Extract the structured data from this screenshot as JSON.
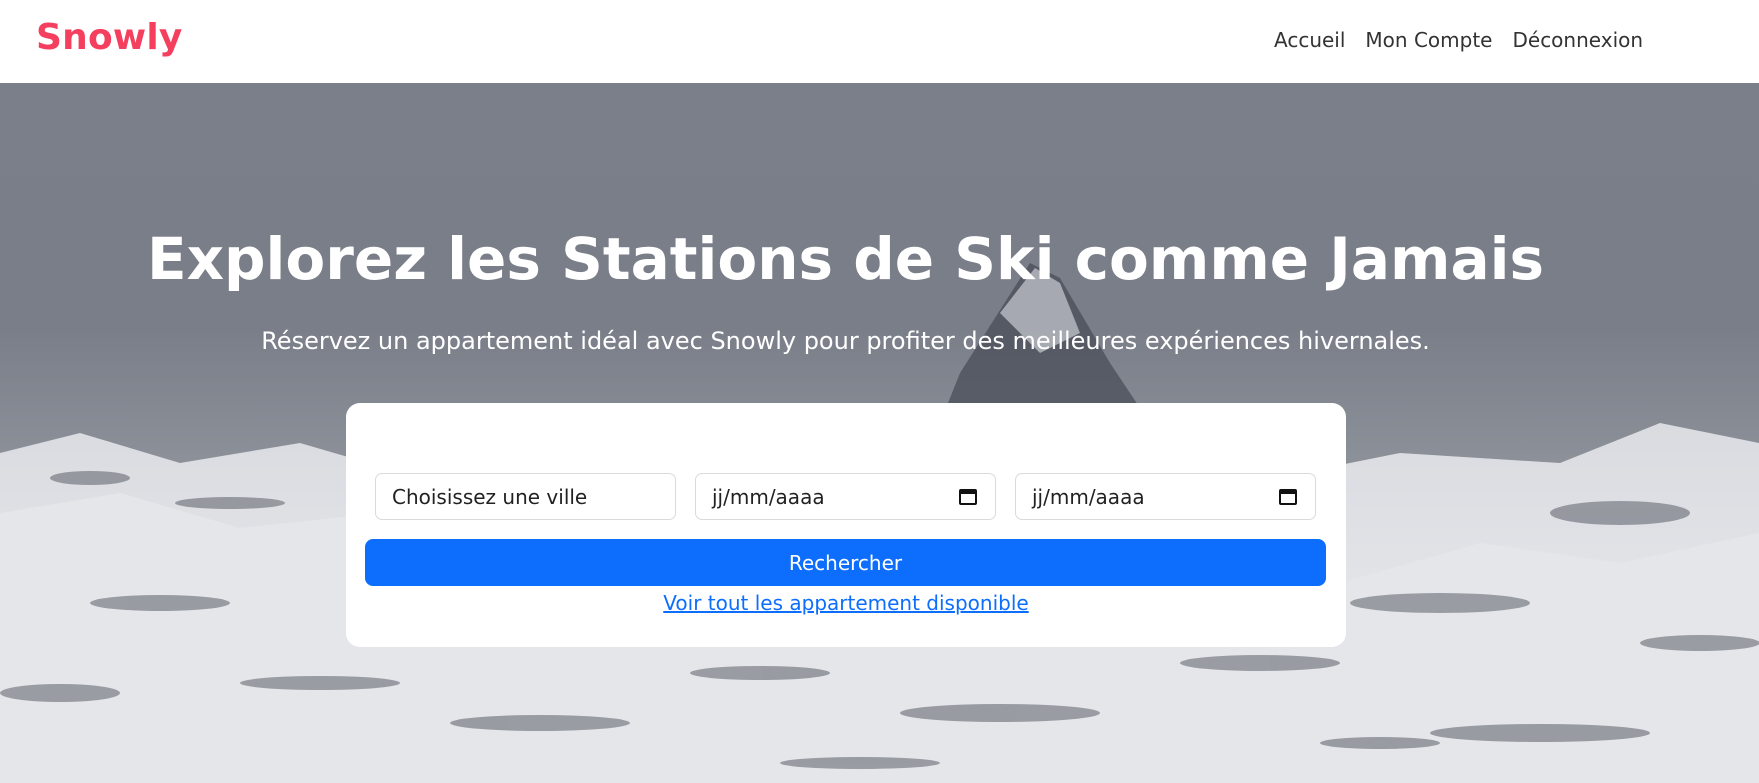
{
  "brand": {
    "name": "Snowly"
  },
  "nav": {
    "items": [
      {
        "label": "Accueil"
      },
      {
        "label": "Mon Compte"
      },
      {
        "label": "Déconnexion"
      }
    ]
  },
  "hero": {
    "title": "Explorez les Stations de Ski comme Jamais",
    "subtitle": "Réservez un appartement idéal avec Snowly pour profiter des meilleures expériences hivernales."
  },
  "search": {
    "city_placeholder": "Choisissez une ville",
    "arrival_placeholder": "jj/mm/aaaa",
    "departure_placeholder": "jj/mm/aaaa",
    "button_label": "Rechercher",
    "all_link_label": "Voir tout les appartement disponible"
  },
  "colors": {
    "brand": "#f43f5e",
    "primary": "#0d6efd"
  }
}
